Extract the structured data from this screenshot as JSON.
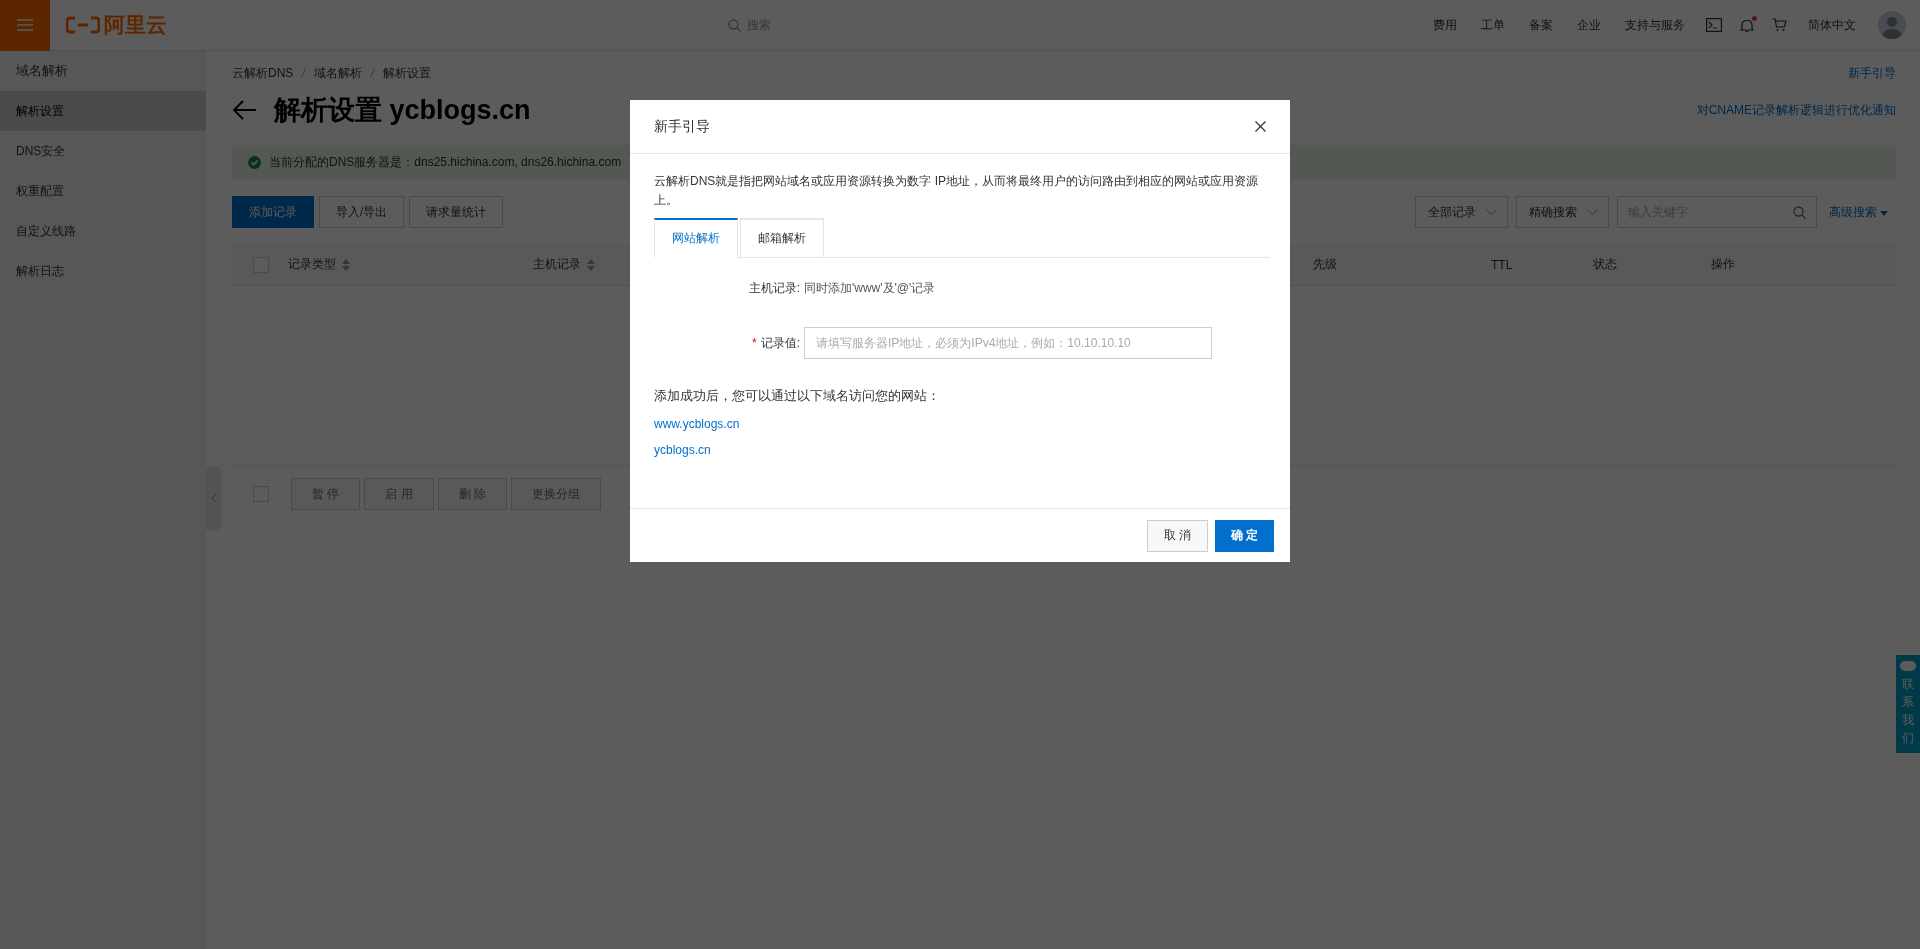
{
  "topbar": {
    "logo_text": "阿里云",
    "search_placeholder": "搜索",
    "nav": [
      "费用",
      "工单",
      "备案",
      "企业",
      "支持与服务"
    ],
    "bell_unread": true,
    "language": "简体中文"
  },
  "sidebar": {
    "title": "域名解析",
    "items": [
      {
        "label": "解析设置",
        "selected": true
      },
      {
        "label": "DNS安全",
        "selected": false
      },
      {
        "label": "权重配置",
        "selected": false
      },
      {
        "label": "自定义线路",
        "selected": false
      },
      {
        "label": "解析日志",
        "selected": false
      }
    ]
  },
  "breadcrumb": [
    "云解析DNS",
    "域名解析",
    "解析设置"
  ],
  "guide_link": "新手引导",
  "page_title": "解析设置 ycblogs.cn",
  "notice_link": "对CNAME记录解析逻辑进行优化通知",
  "alert": "当前分配的DNS服务器是：dns25.hichina.com, dns26.hichina.com",
  "actions": [
    {
      "label": "添加记录",
      "kind": "primary"
    },
    {
      "label": "导入/导出",
      "kind": "normal"
    },
    {
      "label": "请求量统计",
      "kind": "normal"
    }
  ],
  "filters": [
    "全部记录",
    "精确搜索"
  ],
  "search_placeholder": "输入关键字",
  "advanced_search": "高级搜索",
  "table": {
    "select_all_checked": false,
    "columns": [
      {
        "label": "记录类型",
        "sortable": true
      },
      {
        "label": "主机记录",
        "sortable": true
      },
      {
        "label": "先级",
        "sortable": false
      },
      {
        "label": "TTL",
        "sortable": false
      },
      {
        "label": "状态",
        "sortable": false
      },
      {
        "label": "操作",
        "sortable": false
      }
    ]
  },
  "bulk_actions": {
    "checked": false,
    "disabled": true,
    "buttons": [
      "暂 停",
      "启 用",
      "删 除",
      "更换分组"
    ]
  },
  "contact_tab": "联系我们",
  "modal": {
    "title": "新手引导",
    "description": "云解析DNS就是指把网站域名或应用资源转换为数字 IP地址，从而将最终用户的访问路由到相应的网站或应用资源上。",
    "tabs": [
      {
        "label": "网站解析",
        "selected": true
      },
      {
        "label": "邮箱解析",
        "selected": false
      }
    ],
    "host_label": "主机记录:",
    "host_value": "同时添加'www'及'@'记录",
    "value_label": "记录值:",
    "required_mark": "*",
    "value_placeholder": "请填写服务器IP地址，必须为IPv4地址，例如：10.10.10.10",
    "result_text": "添加成功后，您可以通过以下域名访问您的网站：",
    "links": [
      "www.ycblogs.cn",
      "ycblogs.cn"
    ],
    "buttons": [
      {
        "label": "取 消",
        "kind": "normal"
      },
      {
        "label": "确 定",
        "kind": "primary"
      }
    ]
  }
}
